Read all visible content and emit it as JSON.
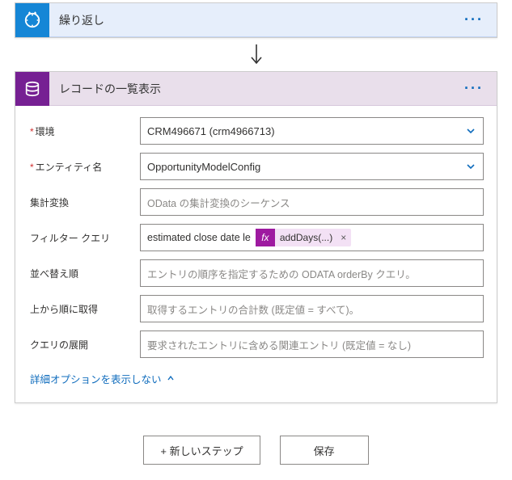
{
  "steps": {
    "recurrence": {
      "title": "繰り返し"
    },
    "listRecords": {
      "title": "レコードの一覧表示",
      "fields": {
        "environment": {
          "label": "環境",
          "required": true,
          "value": "CRM496671 (crm4966713)"
        },
        "entity": {
          "label": "エンティティ名",
          "required": true,
          "value": "OpportunityModelConfig"
        },
        "aggregate": {
          "label": "集計変換",
          "placeholder": "OData の集計変換のシーケンス"
        },
        "filter": {
          "label": "フィルター クエリ",
          "prefix_text": "estimated close date le",
          "token": {
            "fx_label": "fx",
            "label": "addDays(...)"
          }
        },
        "orderBy": {
          "label": "並べ替え順",
          "placeholder": "エントリの順序を指定するための ODATA orderBy クエリ。"
        },
        "top": {
          "label": "上から順に取得",
          "placeholder": "取得するエントリの合計数 (既定値 = すべて)。"
        },
        "expand": {
          "label": "クエリの展開",
          "placeholder": "要求されたエントリに含める関連エントリ (既定値 = なし)"
        }
      },
      "advanced_toggle": "詳細オプションを表示しない"
    }
  },
  "footer": {
    "new_step": "+ 新しいステップ",
    "save": "保存"
  }
}
